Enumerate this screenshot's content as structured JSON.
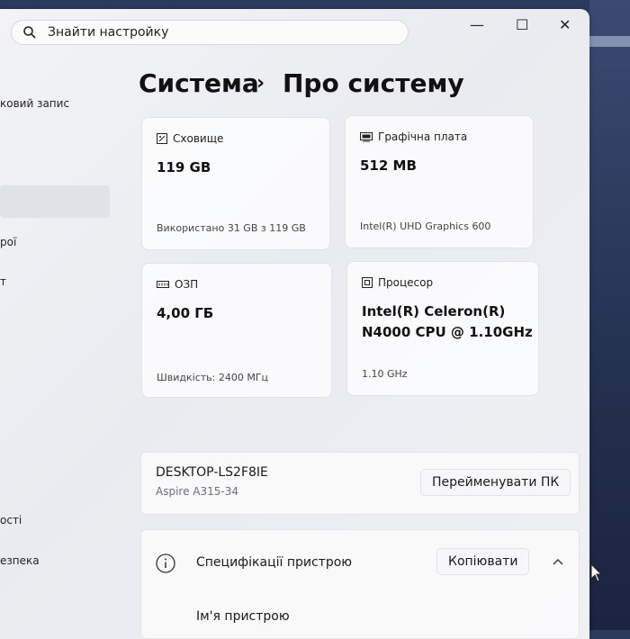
{
  "search": {
    "placeholder": "Знайти настройку"
  },
  "window_controls": {
    "minimize": "—",
    "maximize": "☐",
    "close": "✕"
  },
  "sidebar": {
    "items": [
      {
        "label": "ковий запис"
      },
      {
        "label": "рої"
      },
      {
        "label": "т"
      },
      {
        "label": "ості"
      },
      {
        "label": "езпека"
      }
    ]
  },
  "header": {
    "section": "Система",
    "separator": "›",
    "page": "Про систему"
  },
  "cards": {
    "storage": {
      "title": "Сховище",
      "value": "119 GB",
      "detail": "Використано 31 GB з 119 GB",
      "icon": "storage-icon"
    },
    "gpu": {
      "title": "Графічна плата",
      "value": "512 MB",
      "detail": "Intel(R) UHD Graphics 600",
      "icon": "gpu-icon"
    },
    "ram": {
      "title": "ОЗП",
      "value": "4,00 ГБ",
      "detail": "Швидкість: 2400 МГц",
      "icon": "ram-icon"
    },
    "cpu": {
      "title": "Процесор",
      "value_line1": "Intel(R) Celeron(R)",
      "value_line2": "N4000 CPU @ 1.10GHz",
      "detail": "1.10 GHz",
      "icon": "cpu-icon"
    }
  },
  "device": {
    "name": "DESKTOP-LS2F8IE",
    "model": "Aspire A315-34",
    "rename_label": "Перейменувати ПК"
  },
  "specs": {
    "label": "Специфікації пристрою",
    "copy_label": "Копіювати",
    "first_row_label": "Ім'я пристрою"
  }
}
